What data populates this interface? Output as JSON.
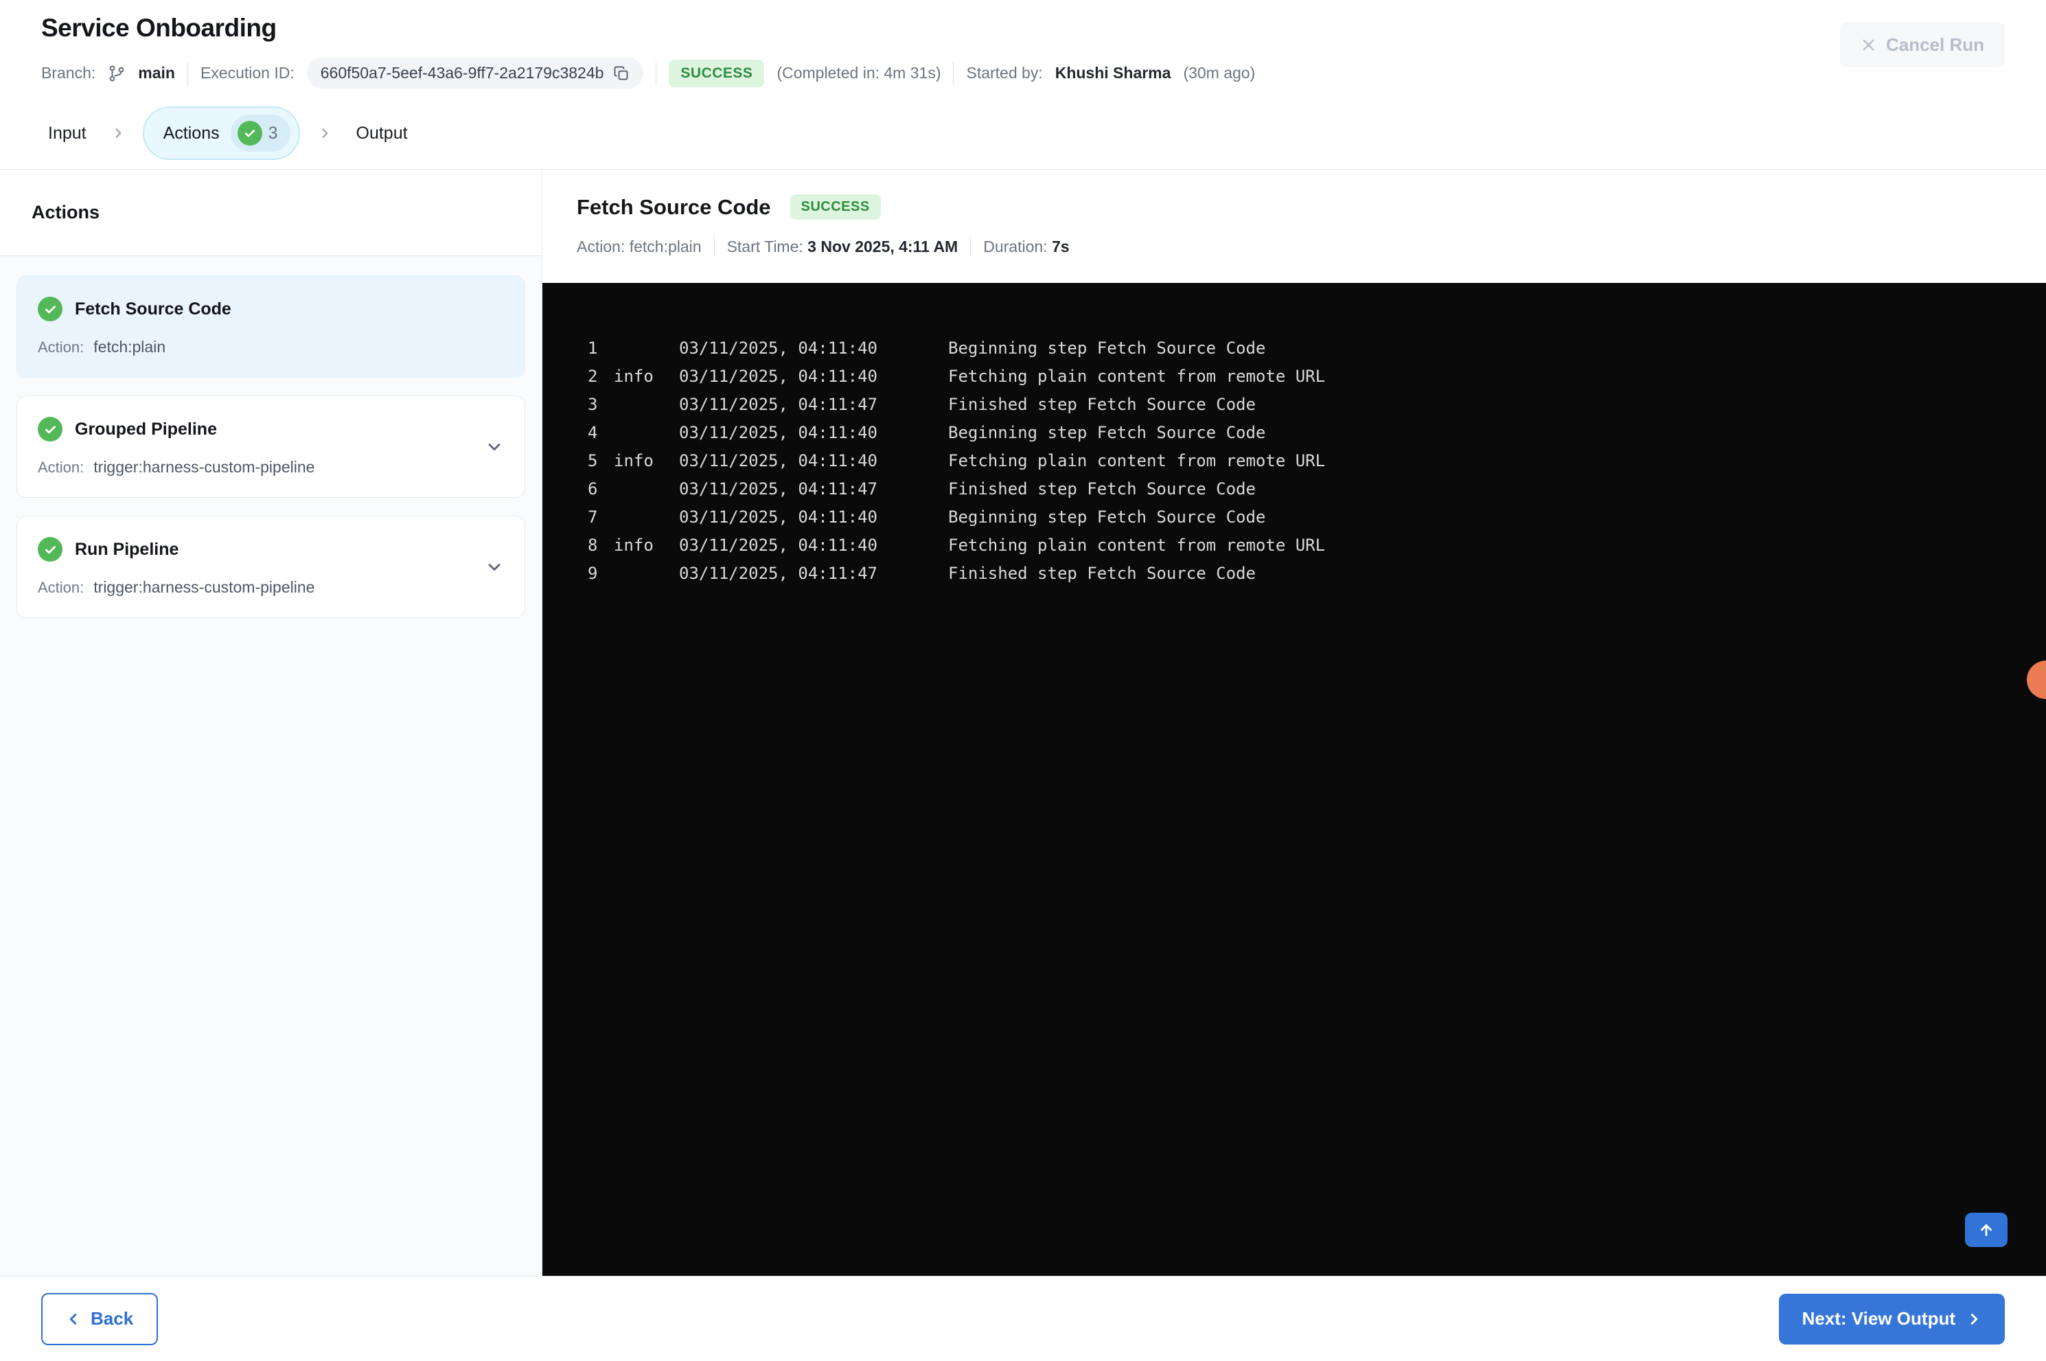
{
  "header": {
    "title": "Service Onboarding",
    "branch_label": "Branch:",
    "branch_name": "main",
    "execution_id_label": "Execution ID:",
    "execution_id": "660f50a7-5eef-43a6-9ff7-2a2179c3824b",
    "status": "SUCCESS",
    "completed_in": "(Completed in: 4m 31s)",
    "started_by_label": "Started by:",
    "started_by": "Khushi Sharma",
    "started_ago": "(30m ago)",
    "cancel_button": "Cancel Run"
  },
  "stepper": {
    "steps": [
      {
        "label": "Input"
      },
      {
        "label": "Actions",
        "count": "3",
        "active": true
      },
      {
        "label": "Output"
      }
    ]
  },
  "sidebar": {
    "title": "Actions",
    "items": [
      {
        "title": "Fetch Source Code",
        "action_label": "Action:",
        "action": "fetch:plain",
        "status": "success",
        "selected": true,
        "expandable": false
      },
      {
        "title": "Grouped Pipeline",
        "action_label": "Action:",
        "action": "trigger:harness-custom-pipeline",
        "status": "success",
        "selected": false,
        "expandable": true
      },
      {
        "title": "Run Pipeline",
        "action_label": "Action:",
        "action": "trigger:harness-custom-pipeline",
        "status": "success",
        "selected": false,
        "expandable": true
      }
    ]
  },
  "detail": {
    "title": "Fetch Source Code",
    "status": "SUCCESS",
    "meta": {
      "action_label": "Action:",
      "action": "fetch:plain",
      "start_label": "Start Time:",
      "start": "3 Nov 2025, 4:11 AM",
      "duration_label": "Duration:",
      "duration": "7s"
    },
    "log_lines": [
      {
        "n": "1",
        "level": "",
        "ts": "03/11/2025, 04:11:40",
        "msg": "Beginning step Fetch Source Code"
      },
      {
        "n": "2",
        "level": "info",
        "ts": "03/11/2025, 04:11:40",
        "msg": "Fetching plain content from remote URL"
      },
      {
        "n": "3",
        "level": "",
        "ts": "03/11/2025, 04:11:47",
        "msg": "Finished step Fetch Source Code"
      },
      {
        "n": "4",
        "level": "",
        "ts": "03/11/2025, 04:11:40",
        "msg": "Beginning step Fetch Source Code"
      },
      {
        "n": "5",
        "level": "info",
        "ts": "03/11/2025, 04:11:40",
        "msg": "Fetching plain content from remote URL"
      },
      {
        "n": "6",
        "level": "",
        "ts": "03/11/2025, 04:11:47",
        "msg": "Finished step Fetch Source Code"
      },
      {
        "n": "7",
        "level": "",
        "ts": "03/11/2025, 04:11:40",
        "msg": "Beginning step Fetch Source Code"
      },
      {
        "n": "8",
        "level": "info",
        "ts": "03/11/2025, 04:11:40",
        "msg": "Fetching plain content from remote URL"
      },
      {
        "n": "9",
        "level": "",
        "ts": "03/11/2025, 04:11:47",
        "msg": "Finished step Fetch Source Code"
      }
    ]
  },
  "footer": {
    "back_button": "Back",
    "next_button": "Next: View Output"
  },
  "colors": {
    "accent_blue": "#3273d8",
    "success_green": "#53b857",
    "success_badge_bg": "#ddf5df",
    "success_badge_text": "#2f8d3f",
    "active_tab_bg": "#e9f8fe",
    "active_tab_border": "#c3e9f6",
    "log_bg": "#0a0a0a",
    "notify_orange": "#ea7b52"
  }
}
